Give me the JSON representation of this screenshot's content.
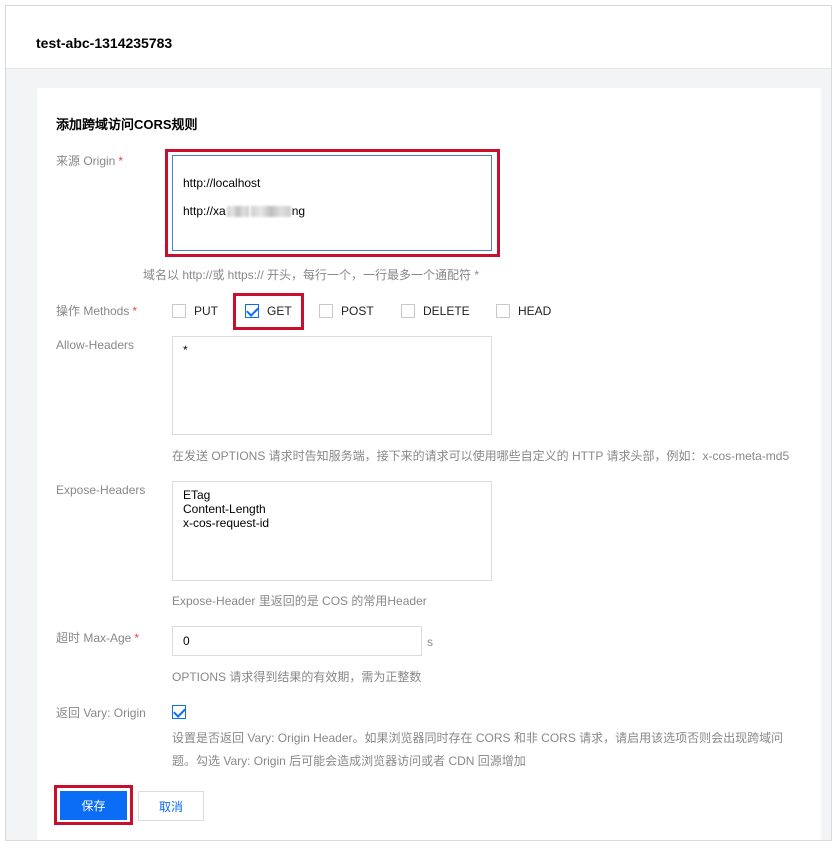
{
  "header": {
    "title": "test-abc-1314235783"
  },
  "form": {
    "section_title": "添加跨域访问CORS规则",
    "origin": {
      "label": "来源 Origin",
      "required_mark": "*",
      "line1": "http://localhost",
      "line2_prefix": "http://xa",
      "line2_suffix": "ng",
      "hint": "域名以 http://或 https:// 开头，每行一个，一行最多一个通配符 *"
    },
    "methods": {
      "label": "操作 Methods",
      "required_mark": "*",
      "options": [
        {
          "label": "PUT",
          "checked": false
        },
        {
          "label": "GET",
          "checked": true
        },
        {
          "label": "POST",
          "checked": false
        },
        {
          "label": "DELETE",
          "checked": false
        },
        {
          "label": "HEAD",
          "checked": false
        }
      ]
    },
    "allow_headers": {
      "label": "Allow-Headers",
      "value": "*",
      "hint": "在发送 OPTIONS 请求时告知服务端，接下来的请求可以使用哪些自定义的 HTTP 请求头部，例如：x-cos-meta-md5"
    },
    "expose_headers": {
      "label": "Expose-Headers",
      "value": "ETag\nContent-Length\nx-cos-request-id",
      "hint": "Expose-Header 里返回的是 COS 的常用Header"
    },
    "max_age": {
      "label": "超时 Max-Age",
      "required_mark": "*",
      "value": "0",
      "unit": "s",
      "hint": "OPTIONS 请求得到结果的有效期，需为正整数"
    },
    "vary": {
      "label": "返回 Vary: Origin",
      "checked": true,
      "hint_line1": "设置是否返回 Vary: Origin Header。如果浏览器同时存在 CORS 和非 CORS 请求，请启用该选项否则会出现跨域问",
      "hint_line2": "题。勾选 Vary: Origin 后可能会造成浏览器访问或者 CDN 回源增加"
    }
  },
  "actions": {
    "save_label": "保存",
    "cancel_label": "取消"
  },
  "colors": {
    "primary": "#0b6cf5",
    "highlight": "#c8102e",
    "required": "#e54545"
  }
}
